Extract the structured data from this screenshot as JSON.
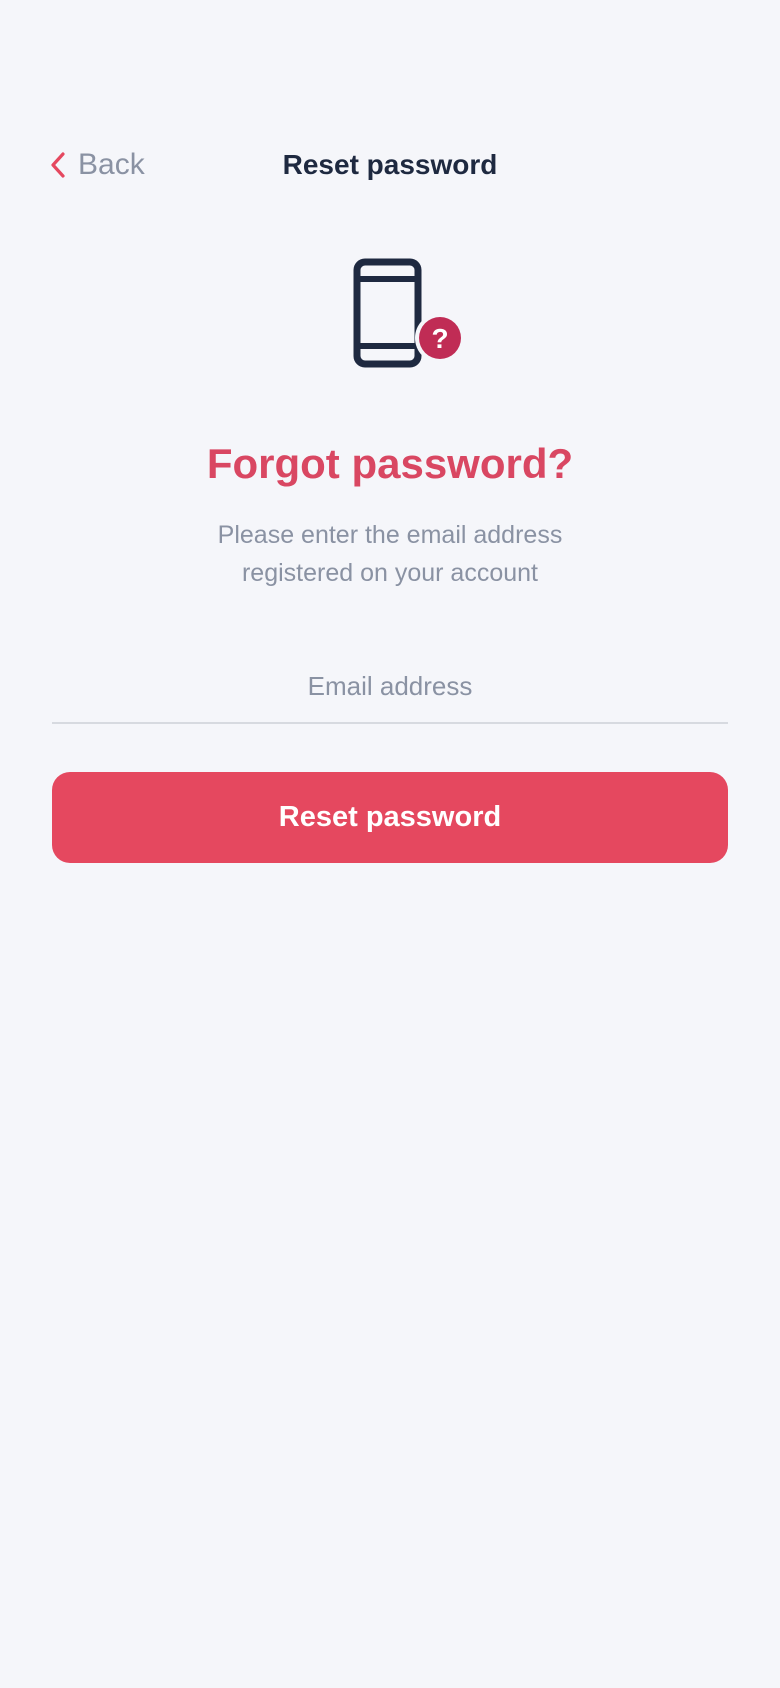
{
  "header": {
    "back_label": "Back",
    "title": "Reset password"
  },
  "illustration": {
    "device_icon": "smartphone-icon",
    "badge_icon": "question-mark-icon",
    "badge_glyph": "?"
  },
  "main": {
    "heading": "Forgot password?",
    "subtitle_line1": "Please enter the email address",
    "subtitle_line2": "registered on your account",
    "email_placeholder": "Email address",
    "email_value": "",
    "submit_label": "Reset password"
  },
  "colors": {
    "background": "#F5F6FA",
    "accent": "#E5485F",
    "heading": "#D94762",
    "badge": "#C02C55",
    "icon_dark": "#1E2940",
    "muted_text": "#8A92A3"
  }
}
